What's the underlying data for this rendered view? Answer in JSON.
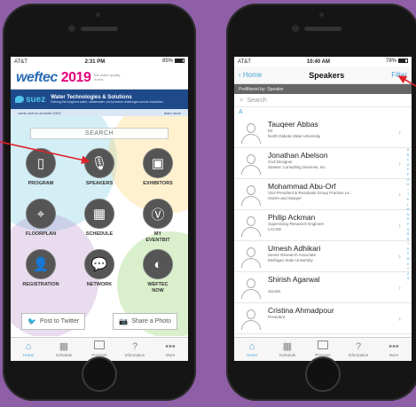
{
  "left": {
    "status": {
      "carrier": "AT&T",
      "time": "2:31 PM",
      "battery": "85%",
      "battery_level": 0.85
    },
    "banner": {
      "logo_main": "wef",
      "logo_rest": "tec",
      "logo_year": "2019",
      "tagline": "the water quality event",
      "sponsor_name": "suez",
      "sponsor_title": "Water Technologies & Solutions",
      "sponsor_subtitle": "Solving the toughest water, wastewater, and process challenges across industries",
      "booth_text": "come visit us at booth 2302",
      "booth_link": "learn more"
    },
    "search_label": "SEARCH",
    "tiles": [
      {
        "label": "PROGRAM",
        "icon": "tablet-icon",
        "glyph": "▯"
      },
      {
        "label": "SPEAKERS",
        "icon": "microphone-icon",
        "glyph": "🎙"
      },
      {
        "label": "EXHIBITORS",
        "icon": "easel-icon",
        "glyph": "▣"
      },
      {
        "label": "FLOORPLAN",
        "icon": "map-pin-icon",
        "glyph": "⌖"
      },
      {
        "label": "SCHEDULE",
        "icon": "calendar-icon",
        "glyph": "▦"
      },
      {
        "label": "MY\nEVENTBIT",
        "icon": "eventbit-icon",
        "glyph": "Ⓥ"
      },
      {
        "label": "REGISTRATION",
        "icon": "person-icon",
        "glyph": "👤"
      },
      {
        "label": "NETWORK",
        "icon": "chat-bubbles-icon",
        "glyph": "💬"
      },
      {
        "label": "WEFTEC\nNOW",
        "icon": "weftec-now-icon",
        "glyph": "◐"
      }
    ],
    "social": {
      "twitter": "Post to Twitter",
      "photo": "Share a Photo"
    },
    "tabbar": [
      {
        "label": "Home",
        "icon": "home-icon",
        "glyph": "⌂"
      },
      {
        "label": "Schedule",
        "icon": "calendar-icon",
        "glyph": "▦"
      },
      {
        "label": "Program",
        "icon": "program-icon",
        "glyph": ""
      },
      {
        "label": "Information",
        "icon": "info-icon",
        "glyph": "?"
      },
      {
        "label": "More",
        "icon": "more-icon",
        "glyph": "•••"
      }
    ]
  },
  "right": {
    "status": {
      "carrier": "AT&T",
      "time": "10:40 AM",
      "battery": "78%",
      "battery_level": 0.78
    },
    "nav": {
      "back": "Home",
      "title": "Speakers",
      "filter": "Filter"
    },
    "prefilter": "Prefiltered by: Speaker",
    "search_placeholder": "Search",
    "section": "A",
    "speakers": [
      {
        "name": "Tauqeer Abbas",
        "lines": [
          "Mr.",
          "North Dakota State University"
        ]
      },
      {
        "name": "Jonathan Abelson",
        "lines": [
          "Civil Designer",
          "Stantec Consulting Services, Inc."
        ]
      },
      {
        "name": "Mohammad Abu-Orf",
        "lines": [
          "Vice President & Residuals Group Practice Le...",
          "Hazen and Sawyer"
        ]
      },
      {
        "name": "Philip Ackman",
        "lines": [
          "Supervising Research Engineer",
          "LACSD"
        ]
      },
      {
        "name": "Umesh Adhikari",
        "lines": [
          "Senior Research Associate",
          "Michigan State University"
        ]
      },
      {
        "name": "Shirish Agarwal",
        "lines": [
          "",
          "Jacobs"
        ]
      },
      {
        "name": "Cristina Ahmadpour",
        "lines": [
          "President"
        ]
      }
    ],
    "alphabet": "ABCDEFGHIJKLMNOPQRSTUVWXYZ#",
    "tabbar": [
      {
        "label": "Home",
        "icon": "home-icon",
        "glyph": "⌂"
      },
      {
        "label": "Schedule",
        "icon": "calendar-icon",
        "glyph": "▦"
      },
      {
        "label": "Program",
        "icon": "program-icon",
        "glyph": ""
      },
      {
        "label": "Information",
        "icon": "info-icon",
        "glyph": "?"
      },
      {
        "label": "More",
        "icon": "more-icon",
        "glyph": "•••"
      }
    ]
  },
  "colors": {
    "background": "#8e5fa6",
    "accent": "#4aa3d6",
    "arrow": "#e0202a",
    "banner": "#1e4a8c"
  }
}
